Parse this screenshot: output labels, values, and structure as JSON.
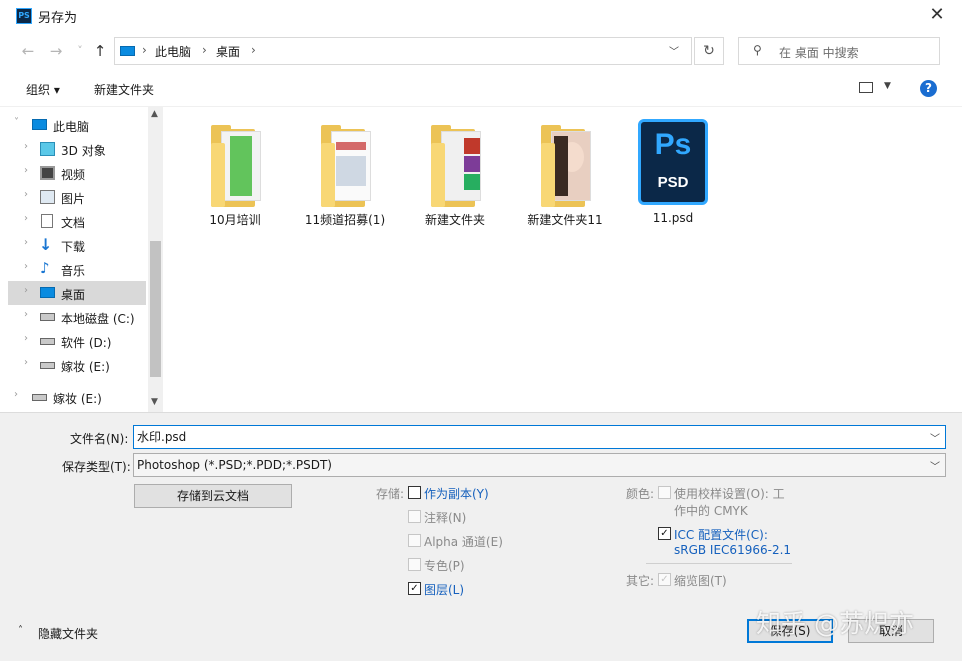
{
  "window": {
    "title": "另存为",
    "app_icon": "PS",
    "close_glyph": "✕"
  },
  "nav": {
    "back_glyph": "←",
    "forward_glyph": "→",
    "recent_glyph": "˅",
    "up_glyph": "↑",
    "breadcrumb": [
      "此电脑",
      "桌面"
    ],
    "refresh_glyph": "↻",
    "search_placeholder": "在 桌面 中搜索"
  },
  "toolbar": {
    "organize": "组织 ▾",
    "new_folder": "新建文件夹",
    "help": "?"
  },
  "sidebar": {
    "items": [
      {
        "label": "此电脑",
        "icon": "computer-icon",
        "level": 0,
        "expanded": true
      },
      {
        "label": "3D 对象",
        "icon": "cube-icon",
        "level": 1
      },
      {
        "label": "视频",
        "icon": "video-icon",
        "level": 1
      },
      {
        "label": "图片",
        "icon": "picture-icon",
        "level": 1
      },
      {
        "label": "文档",
        "icon": "document-icon",
        "level": 1
      },
      {
        "label": "下载",
        "icon": "download-icon",
        "level": 1
      },
      {
        "label": "音乐",
        "icon": "music-icon",
        "level": 1
      },
      {
        "label": "桌面",
        "icon": "desktop-icon",
        "level": 1,
        "selected": true
      },
      {
        "label": "本地磁盘 (C:)",
        "icon": "drive-icon",
        "level": 1
      },
      {
        "label": "软件 (D:)",
        "icon": "drive-icon",
        "level": 1
      },
      {
        "label": "嫁妆 (E:)",
        "icon": "drive-icon",
        "level": 1
      },
      {
        "label": "嫁妆 (E:)",
        "icon": "drive-icon",
        "level": 0
      }
    ]
  },
  "files": [
    {
      "name": "10月培训",
      "type": "folder",
      "preview": "green-document"
    },
    {
      "name": "11频道招募(1)",
      "type": "folder",
      "preview": "screenshot"
    },
    {
      "name": "新建文件夹",
      "type": "folder",
      "preview": "colored-pages"
    },
    {
      "name": "新建文件夹11",
      "type": "folder",
      "preview": "photo"
    },
    {
      "name": "11.psd",
      "type": "psd",
      "icon_text": "Ps",
      "icon_sub": "PSD"
    }
  ],
  "form": {
    "filename_label": "文件名(N):",
    "filename_value": "水印.psd",
    "filetype_label": "保存类型(T):",
    "filetype_value": "Photoshop (*.PSD;*.PDD;*.PSDT)",
    "cloud_button": "存储到云文档"
  },
  "save_options": {
    "label": "存储:",
    "items": [
      {
        "label": "作为副本(Y)",
        "checked": false,
        "enabled": true
      },
      {
        "label": "注释(N)",
        "checked": false,
        "enabled": false
      },
      {
        "label": "Alpha 通道(E)",
        "checked": false,
        "enabled": false
      },
      {
        "label": "专色(P)",
        "checked": false,
        "enabled": false
      },
      {
        "label": "图层(L)",
        "checked": true,
        "enabled": true
      }
    ]
  },
  "color_options": {
    "label": "颜色:",
    "proof_line1": "使用校样设置(O): 工",
    "proof_line2": "作中的 CMYK",
    "icc_line1": "ICC 配置文件(C):",
    "icc_line2": "sRGB IEC61966-2.1"
  },
  "other_options": {
    "label": "其它:",
    "thumbnail": "缩览图(T)"
  },
  "footer": {
    "hide_folders": "隐藏文件夹",
    "save": "保存(S)",
    "cancel": "取消"
  },
  "watermark": "知乎 @苏炽亦",
  "colors": {
    "accent": "#0078d7",
    "link_blue": "#1560bd",
    "folder": "#ecc356",
    "ps_navy": "#0b2848",
    "ps_blue": "#31a8ff"
  }
}
